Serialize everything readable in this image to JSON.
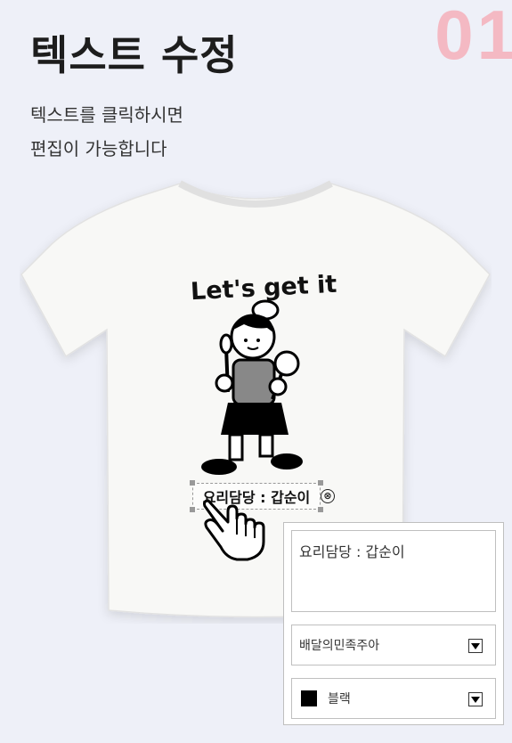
{
  "step_number": "01",
  "title": "텍스트 수정",
  "description": [
    "텍스트를 클릭하시면",
    "편집이 가능합니다"
  ],
  "shirt": {
    "slogan": "Let's get it",
    "editable_text": "요리담당 : 갑순이",
    "delete_symbol": "⊗",
    "cursor_icon": "hand-pointer-icon"
  },
  "editor": {
    "text_value": "요리담당 : 갑순이",
    "font_select": {
      "value": "배달의민족주아"
    },
    "color_select": {
      "value": "블랙",
      "swatch": "#000000"
    }
  },
  "colors": {
    "accent": "#f4b9c3",
    "background": "#eef0f8"
  }
}
